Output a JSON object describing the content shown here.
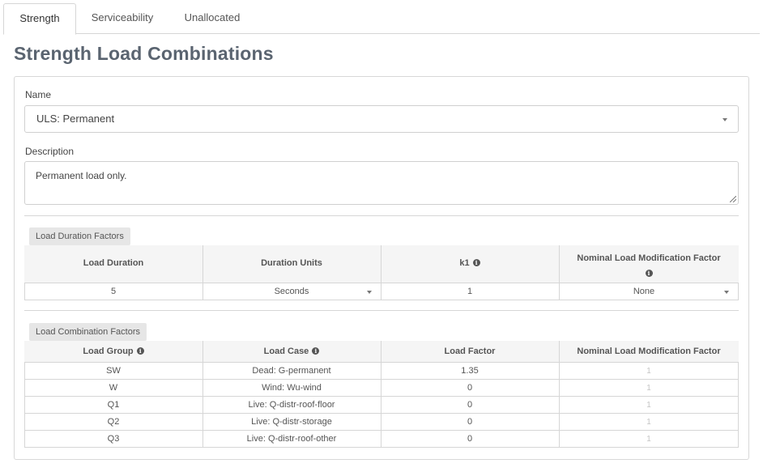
{
  "tabs": [
    {
      "label": "Strength",
      "active": true
    },
    {
      "label": "Serviceability",
      "active": false
    },
    {
      "label": "Unallocated",
      "active": false
    }
  ],
  "page_title": "Strength Load Combinations",
  "form": {
    "name_label": "Name",
    "name_value": "ULS: Permanent",
    "description_label": "Description",
    "description_value": "Permanent load only."
  },
  "duration": {
    "section_label": "Load Duration Factors",
    "headers": {
      "load_duration": "Load Duration",
      "duration_units": "Duration Units",
      "k1": "k1",
      "nominal": "Nominal Load Modification Factor"
    },
    "row": {
      "load_duration": "5",
      "duration_units": "Seconds",
      "k1": "1",
      "nominal": "None"
    }
  },
  "combination": {
    "section_label": "Load Combination Factors",
    "headers": {
      "load_group": "Load Group",
      "load_case": "Load Case",
      "load_factor": "Load Factor",
      "nominal": "Nominal Load Modification Factor"
    },
    "rows": [
      {
        "group": "SW",
        "case": "Dead: G-permanent",
        "factor": "1.35",
        "nominal": "1"
      },
      {
        "group": "W",
        "case": "Wind: Wu-wind",
        "factor": "0",
        "nominal": "1"
      },
      {
        "group": "Q1",
        "case": "Live: Q-distr-roof-floor",
        "factor": "0",
        "nominal": "1"
      },
      {
        "group": "Q2",
        "case": "Live: Q-distr-storage",
        "factor": "0",
        "nominal": "1"
      },
      {
        "group": "Q3",
        "case": "Live: Q-distr-roof-other",
        "factor": "0",
        "nominal": "1"
      }
    ]
  },
  "icons": {
    "info": "info-circle-icon",
    "dropdown": "caret-down-icon",
    "resize": "resize-handle-icon"
  },
  "colors": {
    "title": "#5a6470",
    "border": "#d6d6d6",
    "badge_bg": "#e6e6e6",
    "header_bg": "#f5f5f5",
    "muted_text": "#c4c4c4"
  }
}
